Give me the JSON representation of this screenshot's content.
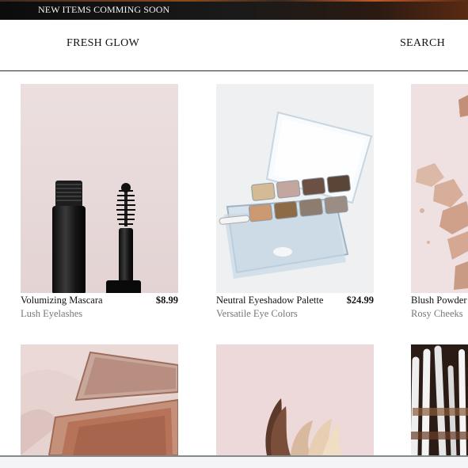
{
  "announcement": "NEW ITEMS COMMING SOON",
  "header": {
    "brand": "FRESH GLOW",
    "search": "SEARCH"
  },
  "products": [
    {
      "name": "Volumizing Mascara",
      "price": "$8.99",
      "subtitle": "Lush Eyelashes"
    },
    {
      "name": "Neutral Eyeshadow Palette",
      "price": "$24.99",
      "subtitle": "Versatile Eye Colors"
    },
    {
      "name": "Blush Powder",
      "price": "",
      "subtitle": "Rosy Cheeks"
    }
  ]
}
